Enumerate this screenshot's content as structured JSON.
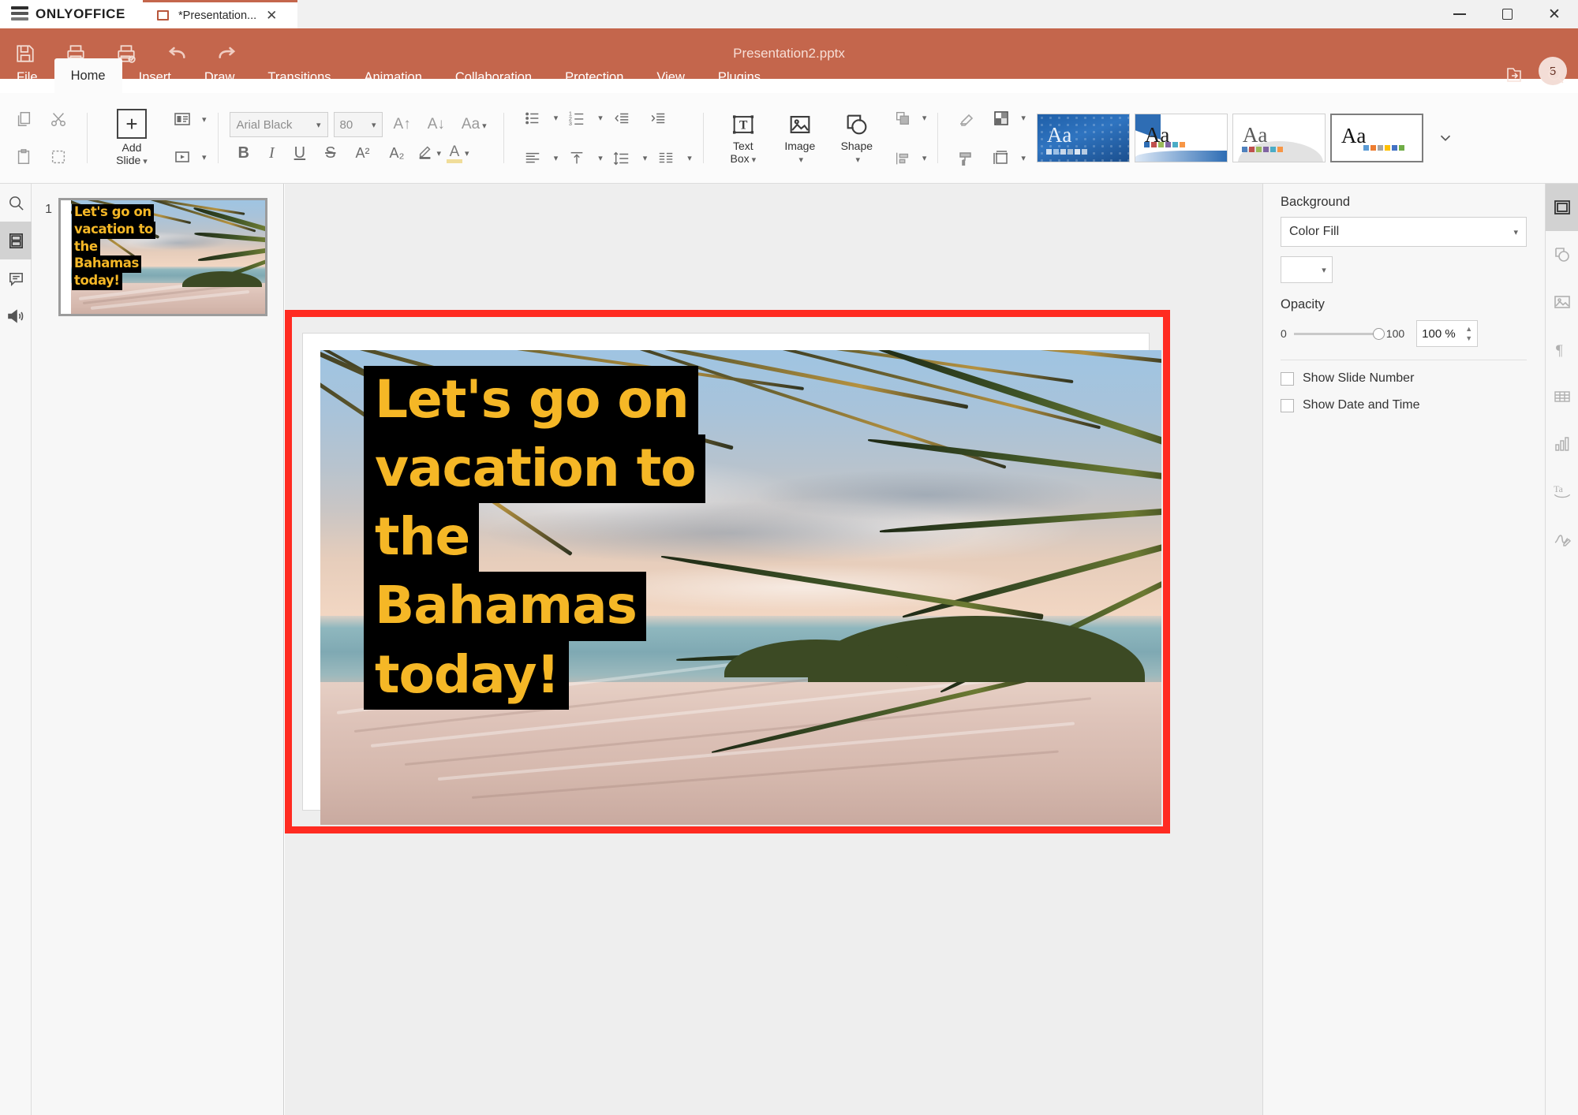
{
  "titlebar": {
    "brand": "ONLYOFFICE",
    "tab_label": "*Presentation...",
    "tab_icon": "presentation-icon",
    "close_icon": "close-icon",
    "minimize_icon": "minimize-icon",
    "maximize_icon": "maximize-icon",
    "window_close_icon": "window-close-icon"
  },
  "header": {
    "doc_title": "Presentation2.pptx",
    "avatar_initial": "5",
    "quick_access": [
      {
        "name": "save-button",
        "icon": "save-icon"
      },
      {
        "name": "print-button",
        "icon": "print-icon"
      },
      {
        "name": "quick-print-button",
        "icon": "quick-print-icon"
      },
      {
        "name": "undo-button",
        "icon": "undo-icon"
      },
      {
        "name": "redo-button",
        "icon": "redo-icon"
      }
    ],
    "right_icons": [
      {
        "name": "open-file-location-button",
        "icon": "open-folder-icon"
      },
      {
        "name": "search-button",
        "icon": "search-icon"
      }
    ]
  },
  "tabs": [
    {
      "label": "File",
      "active": false
    },
    {
      "label": "Home",
      "active": true
    },
    {
      "label": "Insert",
      "active": false
    },
    {
      "label": "Draw",
      "active": false
    },
    {
      "label": "Transitions",
      "active": false
    },
    {
      "label": "Animation",
      "active": false
    },
    {
      "label": "Collaboration",
      "active": false
    },
    {
      "label": "Protection",
      "active": false
    },
    {
      "label": "View",
      "active": false
    },
    {
      "label": "Plugins",
      "active": false
    }
  ],
  "ribbon": {
    "copy_icon": "copy-icon",
    "cut_icon": "cut-icon",
    "paste_icon": "paste-icon",
    "select_all_icon": "select-all-icon",
    "add_slide_label_line1": "Add",
    "add_slide_label_line2": "Slide",
    "layout_icon": "slide-layout-icon",
    "transition_icon": "slide-transition-icon",
    "font_name": "Arial Black",
    "font_size": "80",
    "increase_font_icon": "increase-font-size-icon",
    "decrease_font_icon": "decrease-font-size-icon",
    "change_case_icon": "change-case-icon",
    "bold": "B",
    "italic": "I",
    "underline": "U",
    "strikethrough": "S",
    "superscript": "A²",
    "subscript": "A₂",
    "highlight_icon": "highlight-color-icon",
    "fontcolor_icon": "font-color-icon",
    "fontcolor_value": "#f0dd9a",
    "bullets_icon": "bullet-list-icon",
    "numbering_icon": "numbered-list-icon",
    "decrease_indent_icon": "decrease-indent-icon",
    "increase_indent_icon": "increase-indent-icon",
    "align_icon": "horizontal-align-icon",
    "valign_icon": "vertical-align-icon",
    "linespacing_icon": "line-spacing-icon",
    "columns_icon": "columns-icon",
    "textbox_label_line1": "Text",
    "textbox_label_line2": "Box",
    "image_label": "Image",
    "shape_label": "Shape",
    "arrange_icon": "arrange-icon",
    "align_objects_icon": "align-objects-icon",
    "clear_style_icon": "clear-style-icon",
    "color_scheme_icon": "color-scheme-icon",
    "format_painter_icon": "format-painter-icon",
    "slide_size_icon": "slide-size-icon",
    "themes_expand_icon": "expand-themes-icon",
    "themes": [
      {
        "name": "theme-dotted-blue",
        "label": "Aa",
        "selected": false
      },
      {
        "name": "theme-blue-wave",
        "label": "Aa",
        "selected": false
      },
      {
        "name": "theme-gray-blob",
        "label": "Aa",
        "selected": false
      },
      {
        "name": "theme-office-white",
        "label": "Aa",
        "selected": true
      }
    ]
  },
  "left_rail": [
    {
      "name": "sidebar-search",
      "icon": "search-icon",
      "selected": false
    },
    {
      "name": "sidebar-slides",
      "icon": "slides-icon",
      "selected": true
    },
    {
      "name": "sidebar-comments",
      "icon": "comment-icon",
      "selected": false
    },
    {
      "name": "sidebar-presenter",
      "icon": "presenter-audio-icon",
      "selected": false
    }
  ],
  "slide_panel": {
    "slide_number": "1"
  },
  "slide": {
    "headline_lines": [
      "Let's go on",
      "vacation to",
      "the",
      "Bahamas",
      "today!"
    ],
    "text_color": "#F5B726",
    "highlight_color": "#000000",
    "annotation_border_color": "#FF2B21",
    "image_alt": "tropical beach with palm fronds at sunset"
  },
  "right_panel": {
    "section_title": "Background",
    "fill_type": "Color Fill",
    "fill_color": "#FFFFFF",
    "opacity_label": "Opacity",
    "opacity_min": "0",
    "opacity_max": "100",
    "opacity_value": "100 %",
    "checkboxes": [
      {
        "name": "show-slide-number-checkbox",
        "label": "Show Slide Number",
        "checked": false
      },
      {
        "name": "show-date-and-time-checkbox",
        "label": "Show Date and Time",
        "checked": false
      }
    ]
  },
  "right_rail": [
    {
      "name": "panel-slide-settings",
      "icon": "slide-settings-icon",
      "selected": true
    },
    {
      "name": "panel-shape-settings",
      "icon": "shape-settings-icon",
      "selected": false
    },
    {
      "name": "panel-image-settings",
      "icon": "image-settings-icon",
      "selected": false
    },
    {
      "name": "panel-paragraph-settings",
      "icon": "paragraph-settings-icon",
      "selected": false
    },
    {
      "name": "panel-table-settings",
      "icon": "table-settings-icon",
      "selected": false
    },
    {
      "name": "panel-chart-settings",
      "icon": "chart-settings-icon",
      "selected": false
    },
    {
      "name": "panel-text-art-settings",
      "icon": "text-art-icon",
      "selected": false
    },
    {
      "name": "panel-signature-settings",
      "icon": "signature-icon",
      "selected": false
    }
  ]
}
